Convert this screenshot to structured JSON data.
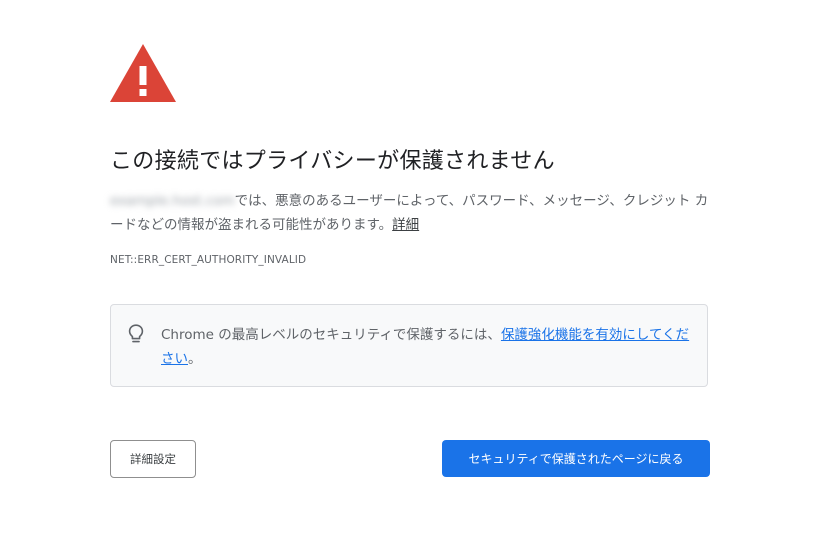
{
  "icons": {
    "warning": "warning-triangle-icon",
    "tip": "lightbulb-icon"
  },
  "colors": {
    "warning_red": "#db4437",
    "primary_blue": "#1a73e8",
    "link_blue": "#1a73e8",
    "box_background": "#f8f9fa",
    "box_border": "#dadce0"
  },
  "interstitial": {
    "title": "この接続ではプライバシーが保護されません",
    "blurred_hostname": "example.host.com",
    "explanation_text": "では、悪意のあるユーザーによって、パスワード、メッセージ、クレジット カードなどの情報が盗まれる可能性があります。",
    "details_link": "詳細",
    "error_code": "NET::ERR_CERT_AUTHORITY_INVALID"
  },
  "enhanced_protection": {
    "text_prefix": "Chrome の最高レベルのセキュリティで保護するには、",
    "link_text": "保護強化機能を有効にしてください",
    "text_suffix": "。"
  },
  "buttons": {
    "advanced_label": "詳細設定",
    "back_to_safety_label": "セキュリティで保護されたページに戻る"
  }
}
